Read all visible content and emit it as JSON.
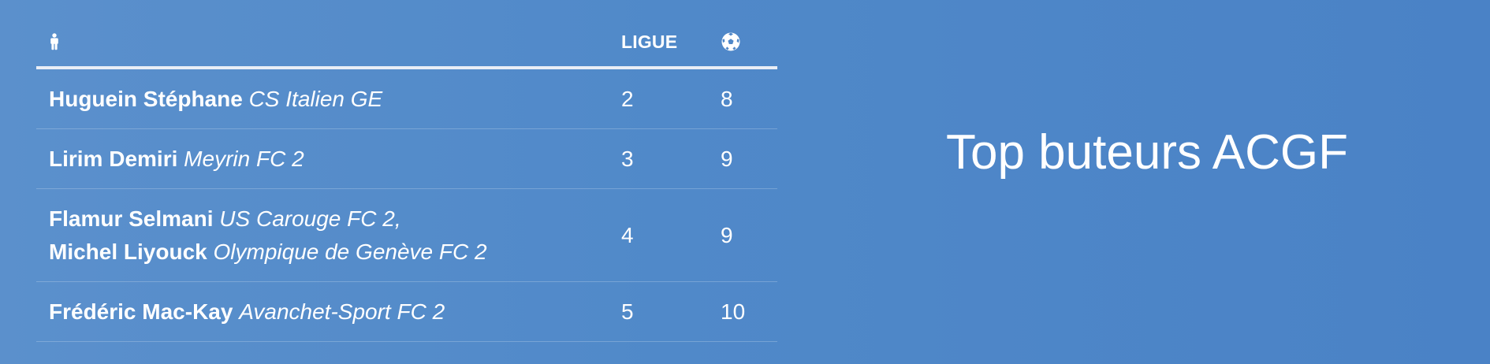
{
  "title": "Top buteurs ACGF",
  "table": {
    "header": {
      "player_icon": "person-icon",
      "league_label": "LIGUE",
      "goals_icon": "soccer-ball-icon"
    },
    "rows": [
      {
        "players": [
          {
            "name": "Huguein Stéphane",
            "club": "CS Italien GE"
          }
        ],
        "league": "2",
        "goals": "8"
      },
      {
        "players": [
          {
            "name": "Lirim Demiri",
            "club": "Meyrin FC 2"
          }
        ],
        "league": "3",
        "goals": "9"
      },
      {
        "players": [
          {
            "name": "Flamur Selmani",
            "club": "US Carouge FC 2,"
          },
          {
            "name": "Michel Liyouck",
            "club": "Olympique de Genève FC 2"
          }
        ],
        "league": "4",
        "goals": "9"
      },
      {
        "players": [
          {
            "name": "Frédéric Mac-Kay",
            "club": "Avanchet-Sport FC 2"
          }
        ],
        "league": "5",
        "goals": "10"
      }
    ]
  },
  "colors": {
    "background": "#5089c9",
    "text": "#ffffff",
    "header_rule": "#e9eef6"
  }
}
